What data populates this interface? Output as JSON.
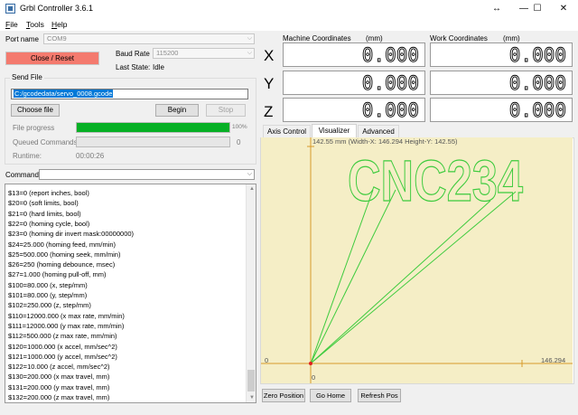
{
  "window": {
    "title": "Grbl Controller 3.6.1",
    "controls": [
      "↔",
      "—",
      "☐",
      "✕"
    ]
  },
  "menu": [
    "File",
    "Tools",
    "Help"
  ],
  "port": {
    "label": "Port name",
    "value": "COM9",
    "baud_label": "Baud Rate",
    "baud_value": "115200",
    "state_label": "Last State:",
    "state_value": "Idle",
    "close_button": "Close / Reset"
  },
  "send_file": {
    "legend": "Send File",
    "path": "C:/gcodedata/servo_0008.gcode",
    "choose_button": "Choose file",
    "begin_button": "Begin",
    "stop_button": "Stop",
    "progress_label": "File progress",
    "progress_value": 1.0,
    "progress_text": "100%",
    "queued_label": "Queued Commands",
    "queued_value": "0",
    "runtime_label": "Runtime:",
    "runtime_value": "00:00:26"
  },
  "command": {
    "label": "Command",
    "value": ""
  },
  "console_lines": [
    "$13=0 (report inches, bool)",
    "$20=0 (soft limits, bool)",
    "$21=0 (hard limits, bool)",
    "$22=0 (homing cycle, bool)",
    "$23=0 (homing dir invert mask:00000000)",
    "$24=25.000 (homing feed, mm/min)",
    "$25=500.000 (homing seek, mm/min)",
    "$26=250 (homing debounce, msec)",
    "$27=1.000 (homing pull-off, mm)",
    "$100=80.000 (x, step/mm)",
    "$101=80.000 (y, step/mm)",
    "$102=250.000 (z, step/mm)",
    "$110=12000.000 (x max rate, mm/min)",
    "$111=12000.000 (y max rate, mm/min)",
    "$112=500.000 (z max rate, mm/min)",
    "$120=1000.000 (x accel, mm/sec^2)",
    "$121=1000.000 (y accel, mm/sec^2)",
    "$122=10.000 (z accel, mm/sec^2)",
    "$130=200.000 (x max travel, mm)",
    "$131=200.000 (y max travel, mm)",
    "$132=200.000 (z max travel, mm)"
  ],
  "coordinates": {
    "machine_label": "Machine Coordinates",
    "machine_unit": "(mm)",
    "work_label": "Work Coordinates",
    "work_unit": "(mm)",
    "axes": [
      {
        "name": "X",
        "machine": "0.000",
        "work": "0.000"
      },
      {
        "name": "Y",
        "machine": "0.000",
        "work": "0.000"
      },
      {
        "name": "Z",
        "machine": "0.000",
        "work": "0.000"
      }
    ]
  },
  "tabs": [
    "Axis Control",
    "Visualizer",
    "Advanced"
  ],
  "visualizer": {
    "header": "142.55 mm  (Width-X: 146.294  Height-Y: 142.55)",
    "x_max_label": "146.294",
    "origin_x_label": "0",
    "origin_y_label": "0",
    "drawing_text": "CNC234",
    "line_color": "#3ecb3e",
    "axis_color": "#d89a2a",
    "origin_color": "#e02020"
  },
  "buttons": {
    "zero": "Zero Position",
    "home": "Go Home",
    "refresh": "Refresh Pos"
  }
}
